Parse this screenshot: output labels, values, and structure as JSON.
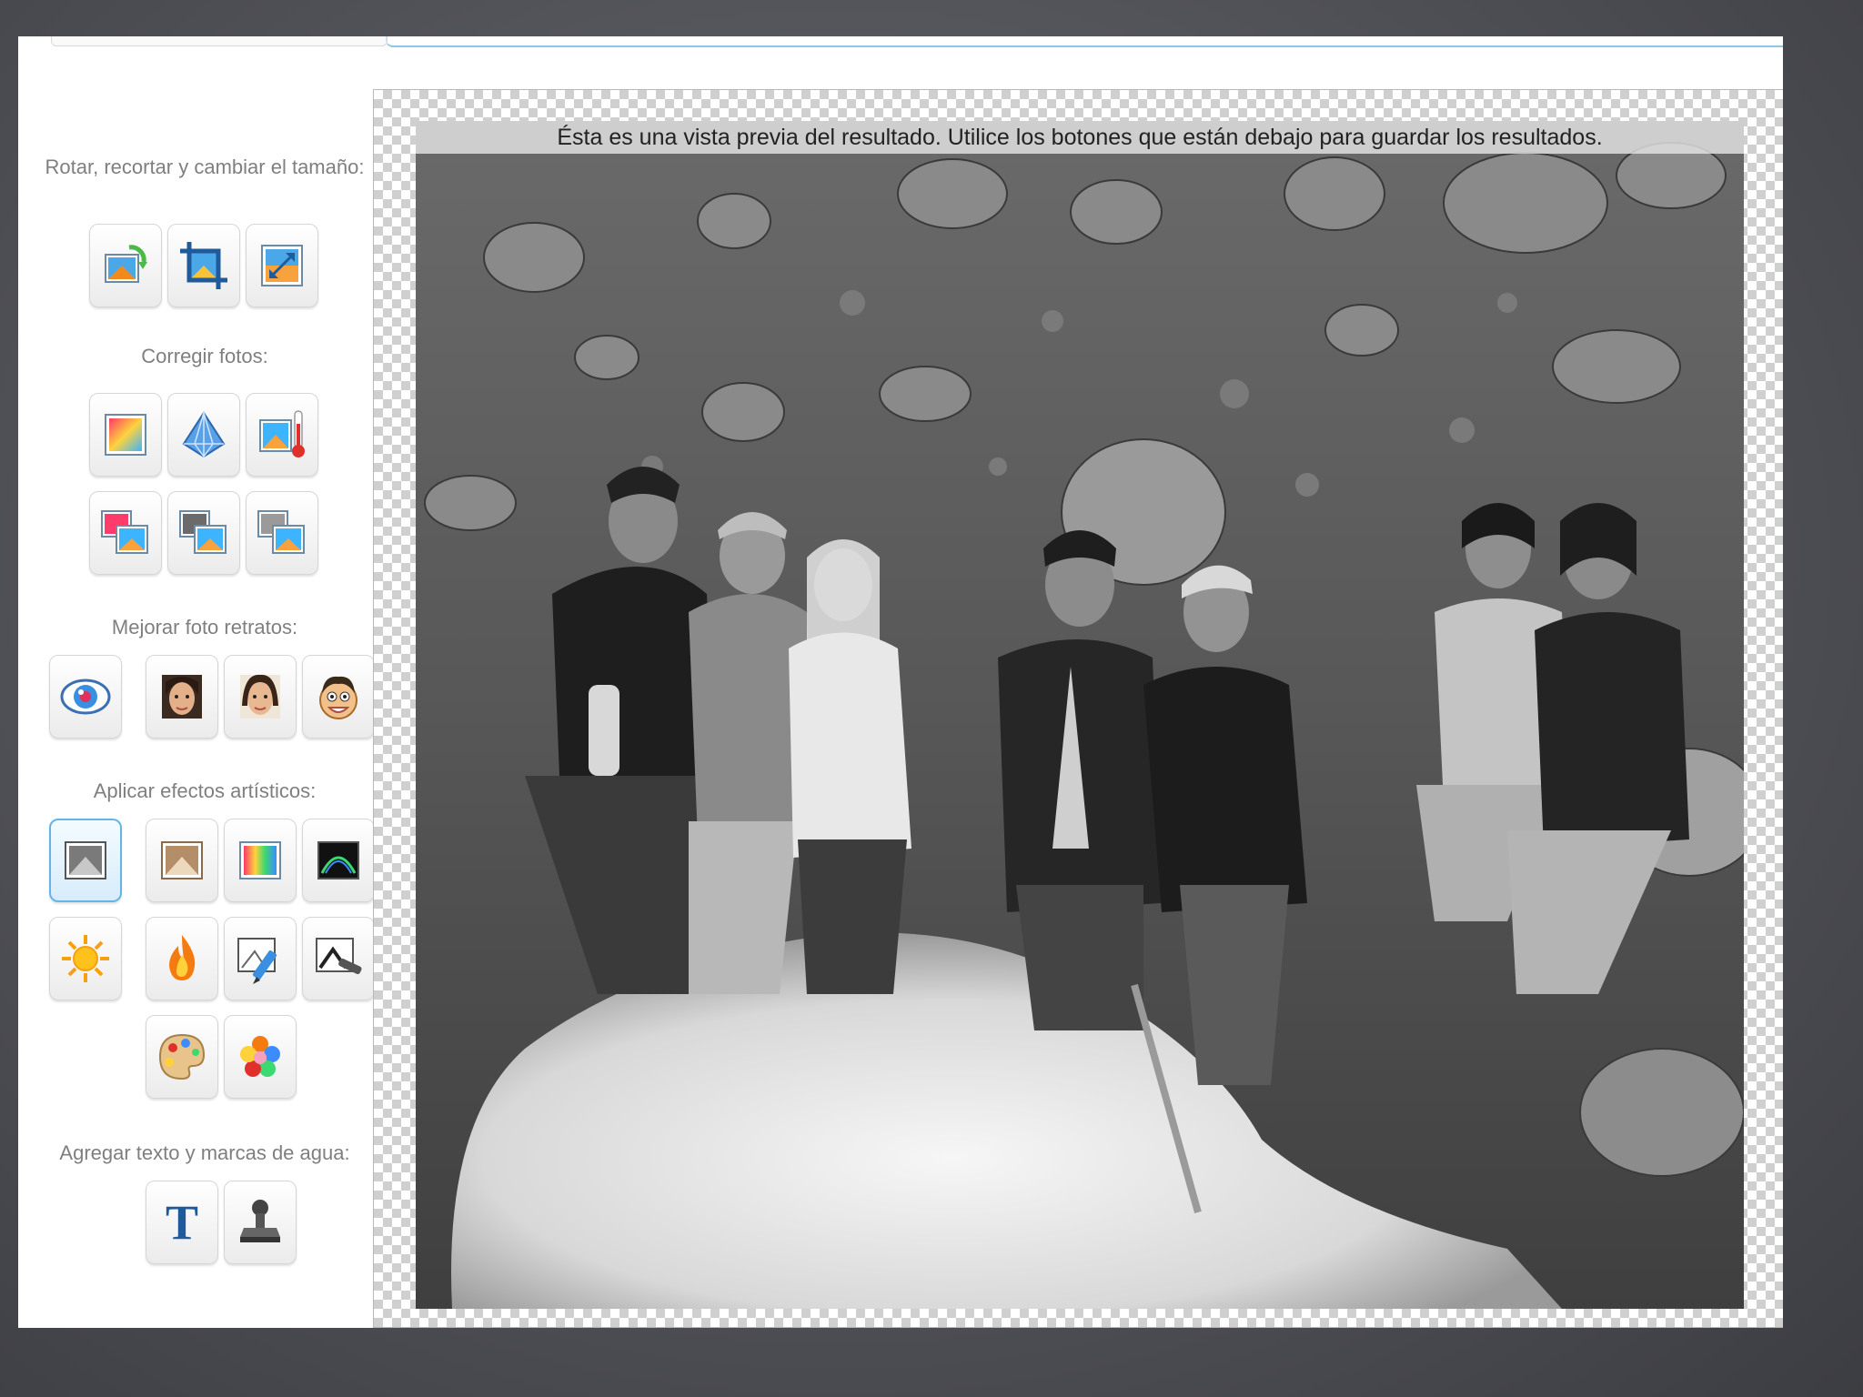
{
  "sidebar": {
    "sections": [
      {
        "label": "Rotar, recortar y cambiar el tamaño:"
      },
      {
        "label": "Corregir fotos:"
      },
      {
        "label": "Mejorar foto retratos:"
      },
      {
        "label": "Aplicar efectos artísticos:"
      },
      {
        "label": "Agregar texto y marcas de agua:"
      }
    ],
    "tools": {
      "rotate": {
        "icon": "rotate-icon"
      },
      "crop": {
        "icon": "crop-icon"
      },
      "resize": {
        "icon": "resize-icon"
      },
      "auto_color": {
        "icon": "color-correction-icon"
      },
      "sharpen": {
        "icon": "diamond-sharpen-icon"
      },
      "temperature": {
        "icon": "thermometer-icon"
      },
      "adjust_1": {
        "icon": "photo-adjust-icon"
      },
      "adjust_2": {
        "icon": "photo-adjust-icon"
      },
      "adjust_3": {
        "icon": "photo-adjust-icon"
      },
      "red_eye": {
        "icon": "eye-icon"
      },
      "skin_smooth": {
        "icon": "face-icon"
      },
      "face_retouch": {
        "icon": "face-icon"
      },
      "caricature": {
        "icon": "cartoon-face-icon"
      },
      "grayscale": {
        "icon": "grayscale-photo-icon",
        "selected": true
      },
      "sepia": {
        "icon": "sepia-photo-icon"
      },
      "color_saturation": {
        "icon": "color-photo-icon"
      },
      "glow_edges": {
        "icon": "glow-edges-icon"
      },
      "sun": {
        "icon": "sun-icon"
      },
      "flame": {
        "icon": "flame-icon"
      },
      "pencil_sketch": {
        "icon": "pencil-sketch-icon"
      },
      "charcoal": {
        "icon": "charcoal-icon"
      },
      "palette": {
        "icon": "palette-icon"
      },
      "flower": {
        "icon": "flower-icon"
      },
      "text": {
        "icon": "text-icon",
        "glyph": "T"
      },
      "watermark": {
        "icon": "stamp-icon"
      }
    }
  },
  "preview": {
    "notice": "Ésta es una vista previa del resultado. Utilice los botones que están debajo para guardar los resultados.",
    "effect": "grayscale"
  },
  "colors": {
    "selected_border": "#64b5e6",
    "accent_line": "#8fc5e6",
    "label_text": "#7f7f7f"
  }
}
